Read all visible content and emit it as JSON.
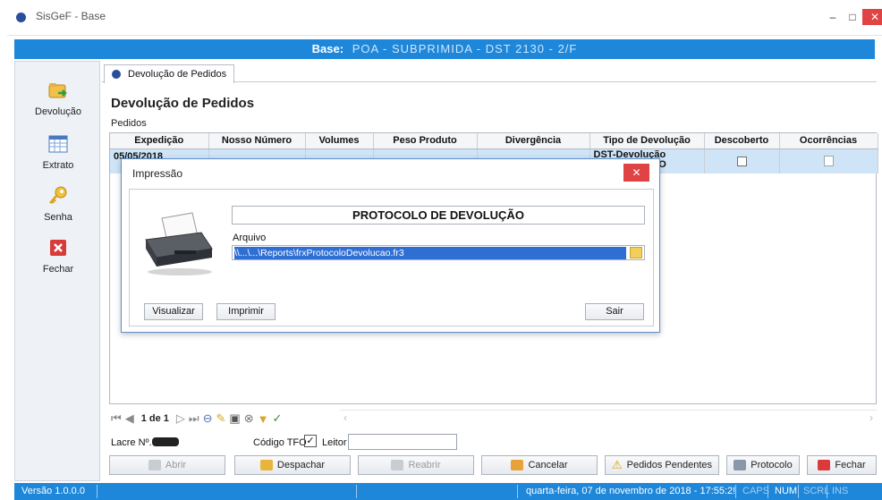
{
  "window": {
    "title": "SisGeF - Base",
    "min_label": "–",
    "max_label": "□",
    "close_label": "✕"
  },
  "basebar": {
    "label": "Base:",
    "value": "POA - SUBPRIMIDA - DST 2130 - 2/F"
  },
  "sidebar": {
    "items": [
      {
        "label": "Devolução",
        "icon": "folder-arrow-icon"
      },
      {
        "label": "Extrato",
        "icon": "table-icon"
      },
      {
        "label": "Senha",
        "icon": "key-icon"
      },
      {
        "label": "Fechar",
        "icon": "close-icon"
      }
    ]
  },
  "tab": {
    "label": "Devolução de Pedidos"
  },
  "main": {
    "title": "Devolução de Pedidos",
    "subtitle": "Pedidos"
  },
  "grid": {
    "columns": [
      "Expedição",
      "Nosso Número",
      "Volumes",
      "Peso Produto",
      "Divergência",
      "Tipo de Devolução",
      "Descoberto",
      "Ocorrências"
    ],
    "row": {
      "expedicao": "05/05/2018",
      "tipo_line1": "DST-Devolução",
      "tipo_line2": "FO"
    }
  },
  "nav": {
    "page": "1 de 1"
  },
  "form": {
    "lacre_label": "Lacre Nº.",
    "tfo_label": "Código TFO",
    "tfo_checked": "✓",
    "leitor_label": "Leitor",
    "leitor_value": ""
  },
  "buttons": {
    "abrir": "Abrir",
    "despachar": "Despachar",
    "reabrir": "Reabrir",
    "cancelar": "Cancelar",
    "pendentes": "Pedidos Pendentes",
    "protocolo": "Protocolo",
    "fechar": "Fechar"
  },
  "status": {
    "version": "Versão 1.0.0.0",
    "datetime": "quarta-feira, 07 de novembro de 2018 - 17:55:2!",
    "caps": "CAPS",
    "num": "NUM",
    "scrl": "SCRL",
    "ins": "INS"
  },
  "dialog": {
    "title": "Impressão",
    "close_label": "✕",
    "protocol_title": "PROTOCOLO DE DEVOLUÇÃO",
    "arquivo_label": "Arquivo",
    "arquivo_value": "\\\\...\\...\\Reports\\frxProtocoloDevolucao.fr3",
    "btn_visualizar": "Visualizar",
    "btn_imprimir": "Imprimir",
    "btn_sair": "Sair"
  },
  "colors": {
    "accent": "#1e87d9",
    "selection": "#2f6fd4",
    "close_red": "#e04343",
    "row_selected": "#cfe4f7"
  }
}
